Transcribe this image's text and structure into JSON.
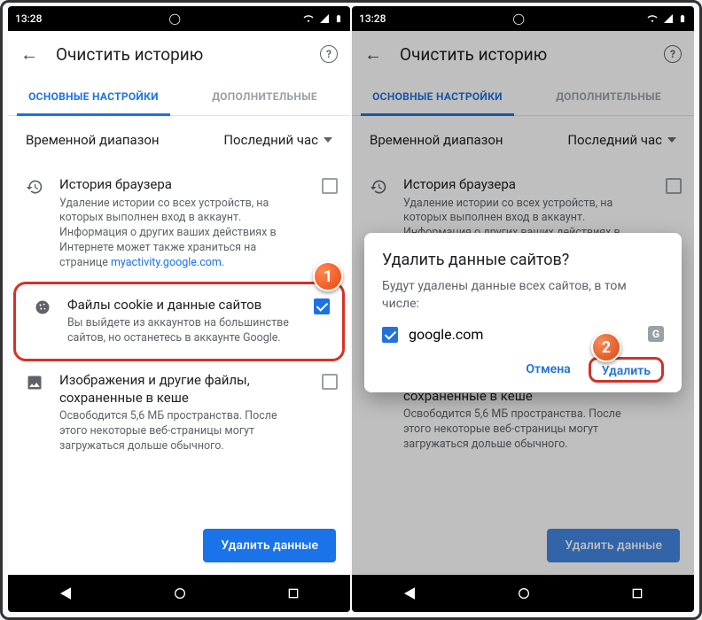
{
  "status": {
    "time": "13:28"
  },
  "appbar": {
    "title": "Очистить историю"
  },
  "tabs": {
    "basic": "ОСНОВНЫЕ НАСТРОЙКИ",
    "advanced": "ДОПОЛНИТЕЛЬНЫЕ"
  },
  "range": {
    "label": "Временной диапазон",
    "value": "Последний час"
  },
  "items": {
    "history": {
      "title": "История браузера",
      "desc": "Удаление истории со всех устройств, на которых выполнен вход в аккаунт. Информация о других ваших действиях в Интернете может также храниться на странице ",
      "link": "myactivity.google.com",
      "tail": "."
    },
    "cookies": {
      "title": "Файлы cookie и данные сайтов",
      "desc": "Вы выйдете из аккаунтов на большинстве сайтов, но останетесь в аккаунте Google."
    },
    "cache": {
      "title": "Изображения и другие файлы, сохраненные в кеше",
      "desc": "Освободится 5,6 МБ пространства. После этого некоторые веб-страницы могут загружаться дольше обычного."
    }
  },
  "clear_button": "Удалить данные",
  "dialog": {
    "title": "Удалить данные сайтов?",
    "text": "Будут удалены данные всех сайтов, в том числе:",
    "site": "google.com",
    "cancel": "Отмена",
    "confirm": "Удалить"
  },
  "badges": {
    "one": "1",
    "two": "2"
  }
}
